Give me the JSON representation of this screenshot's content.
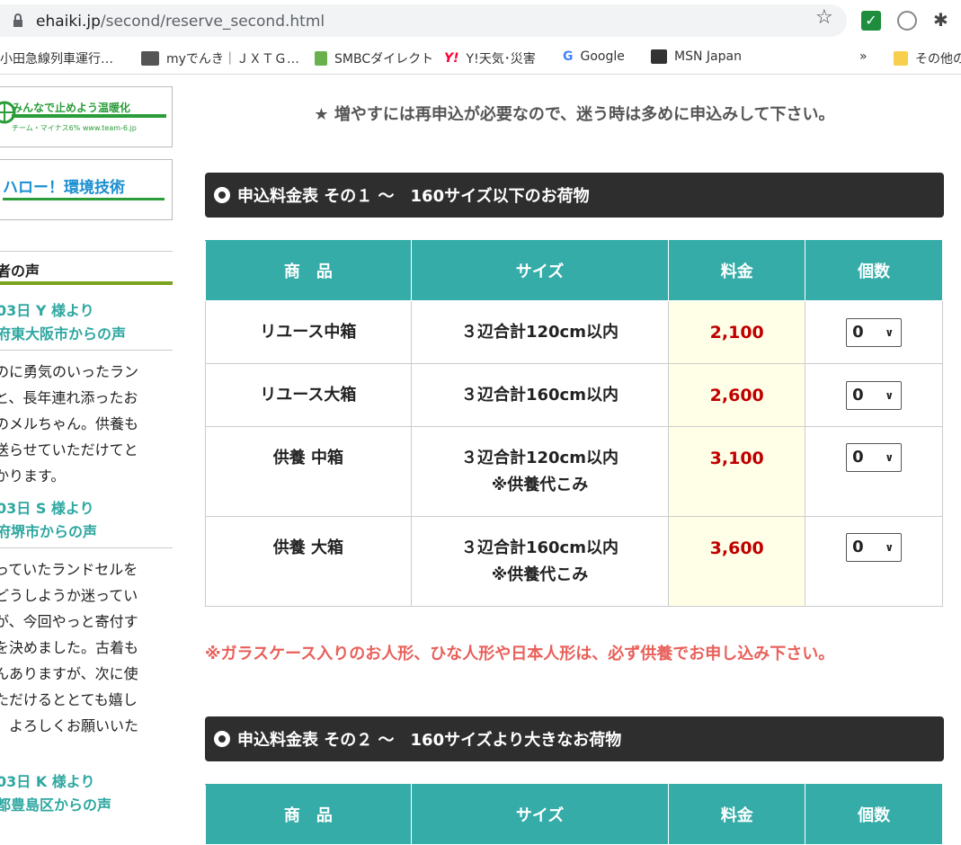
{
  "browser": {
    "url_host": "ehaiki.jp",
    "url_path": "/second/reserve_second.html",
    "bookmarks": [
      {
        "label": "小田急線列車運行…",
        "color": "#ffffff"
      },
      {
        "label": "myでんき｜ＪＸＴＧ…",
        "color": "#555555"
      },
      {
        "label": "SMBCダイレクト",
        "color": "#6ab04c"
      },
      {
        "label": "Y!天気･災害",
        "color": "#ff0033"
      },
      {
        "label": "Google",
        "color": "#4285f4"
      },
      {
        "label": "MSN Japan",
        "color": "#333333"
      }
    ],
    "overflow": "»",
    "other_bookmarks": "その他の"
  },
  "sidebar": {
    "banner1_text": "みんなで止めよう温暖化",
    "banner1_sub": "チーム・マイナス6%  www.team-6.jp",
    "banner2_text": "ハロー！環境技術",
    "voices_heading": "者の声",
    "voices": [
      {
        "title1": "03日 Y 様より",
        "title2": "府東大阪市からの声",
        "lines": [
          "のに勇気のいったラン",
          "と、長年連れ添ったお",
          "のメルちゃん。供養も",
          "送らせていただけてと",
          "かります。"
        ]
      },
      {
        "title1": "03日 S 様より",
        "title2": "府堺市からの声",
        "lines": [
          "っていたランドセルを",
          "どうしようか迷ってい",
          "が、今回やっと寄付す",
          "を決めました。古着も",
          "んありますが、次に使",
          "ただけるととても嬉し",
          "。よろしくお願いいた",
          "！"
        ]
      },
      {
        "title1": "03日 K 様より",
        "title2": "都豊島区からの声",
        "lines": []
      }
    ]
  },
  "main": {
    "notice": "★ 増やすには再申込が必要なので、迷う時は多めに申込みして下さい。",
    "section1_title": "申込料金表 その１ ～　160サイズ以下のお荷物",
    "headers": {
      "product": "商　品",
      "size": "サイズ",
      "fee": "料金",
      "qty": "個数"
    },
    "rows": [
      {
        "product": "リユース中箱",
        "size1": "３辺合計120cm以内",
        "size2": "",
        "fee": "2,100",
        "qty": "0"
      },
      {
        "product": "リユース大箱",
        "size1": "３辺合計160cm以内",
        "size2": "",
        "fee": "2,600",
        "qty": "0"
      },
      {
        "product": "供養 中箱",
        "size1": "３辺合計120cm以内",
        "size2": "※供養代こみ",
        "fee": "3,100",
        "qty": "0"
      },
      {
        "product": "供養 大箱",
        "size1": "３辺合計160cm以内",
        "size2": "※供養代こみ",
        "fee": "3,600",
        "qty": "0"
      }
    ],
    "warning": "※ガラスケース入りのお人形、ひな人形や日本人形は、必ず供養でお申し込み下さい。",
    "section2_title": "申込料金表 その２ ～　160サイズより大きなお荷物",
    "headers2": {
      "product": "商　品",
      "size": "サイズ",
      "fee": "料金",
      "qty": "個数"
    }
  }
}
